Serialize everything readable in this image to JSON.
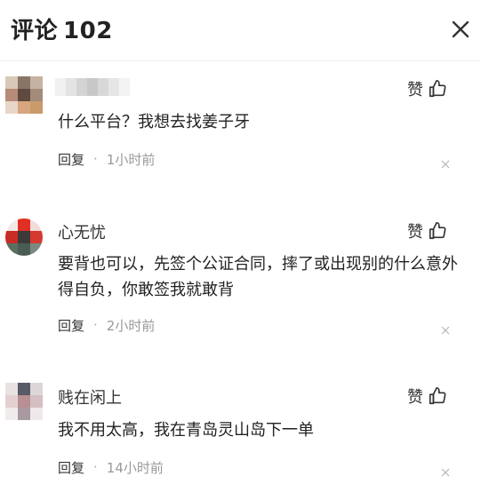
{
  "header": {
    "title": "评论",
    "count": "102"
  },
  "icons": {
    "close": "close-icon",
    "like": "thumbs-up-icon",
    "dismiss": "dismiss-x-icon"
  },
  "colors": {
    "text_primary": "#222222",
    "text_secondary": "#999999"
  },
  "comments": [
    {
      "username": "",
      "username_blurred": true,
      "like_label": "赞",
      "text": "什么平台？我想去找姜子牙",
      "reply_label": "回复",
      "separator": "·",
      "time": "1小时前"
    },
    {
      "username": "心无忧",
      "like_label": "赞",
      "text": "要背也可以，先签个公证合同，摔了或出现别的什么意外得自负，你敢签我就敢背",
      "reply_label": "回复",
      "separator": "·",
      "time": "2小时前"
    },
    {
      "username": "贱在闲上",
      "like_label": "赞",
      "text": "我不用太高，我在青岛灵山岛下一单",
      "reply_label": "回复",
      "separator": "·",
      "time": "14小时前"
    }
  ]
}
